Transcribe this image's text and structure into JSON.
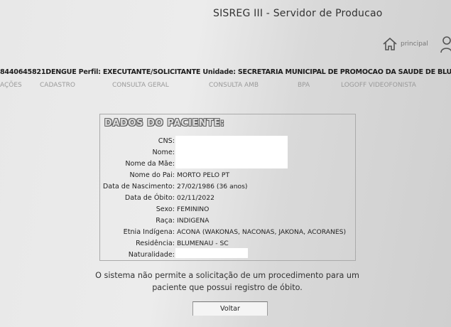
{
  "header": {
    "title": "SISREG III - Servidor de Producao",
    "home_label": "principal"
  },
  "session": {
    "user_id": "8440645821DENGUE",
    "perfil_label": "Perfil:",
    "perfil": "EXECUTANTE/SOLICITANTE",
    "unidade_label": "Unidade:",
    "unidade": "SECRETARIA MUNICIPAL DE PROMOCAO DA SAUDE DE BLUME"
  },
  "menu": [
    "AÇÕES",
    "CADASTRO",
    "CONSULTA GERAL",
    "CONSULTA AMB",
    "BPA",
    "LOGOFF VIDEOFONISTA"
  ],
  "patient": {
    "title": "DADOS DO PACIENTE:",
    "fields": [
      {
        "label": "CNS:",
        "value": ""
      },
      {
        "label": "Nome:",
        "value": ""
      },
      {
        "label": "Nome da Mãe:",
        "value": ""
      },
      {
        "label": "Nome do Pai:",
        "value": "MORTO PELO PT"
      },
      {
        "label": "Data de Nascimento:",
        "value": "27/02/1986 (36 anos)"
      },
      {
        "label": "Data de Óbito:",
        "value": "02/11/2022"
      },
      {
        "label": "Sexo:",
        "value": "FEMININO"
      },
      {
        "label": "Raça:",
        "value": "INDIGENA"
      },
      {
        "label": "Etnia Indígena:",
        "value": "ACONA (WAKONAS, NACONAS, JAKONA, ACORANES)"
      },
      {
        "label": "Residência:",
        "value": "BLUMENAU - SC"
      },
      {
        "label": "Naturalidade:",
        "value": ""
      }
    ]
  },
  "message": {
    "line1": "O sistema não permite a solicitação de um procedimento para um",
    "line2": "paciente que possui registro de óbito."
  },
  "buttons": {
    "voltar": "Voltar"
  },
  "icons": {
    "home": "home-icon",
    "user": "user-icon"
  }
}
